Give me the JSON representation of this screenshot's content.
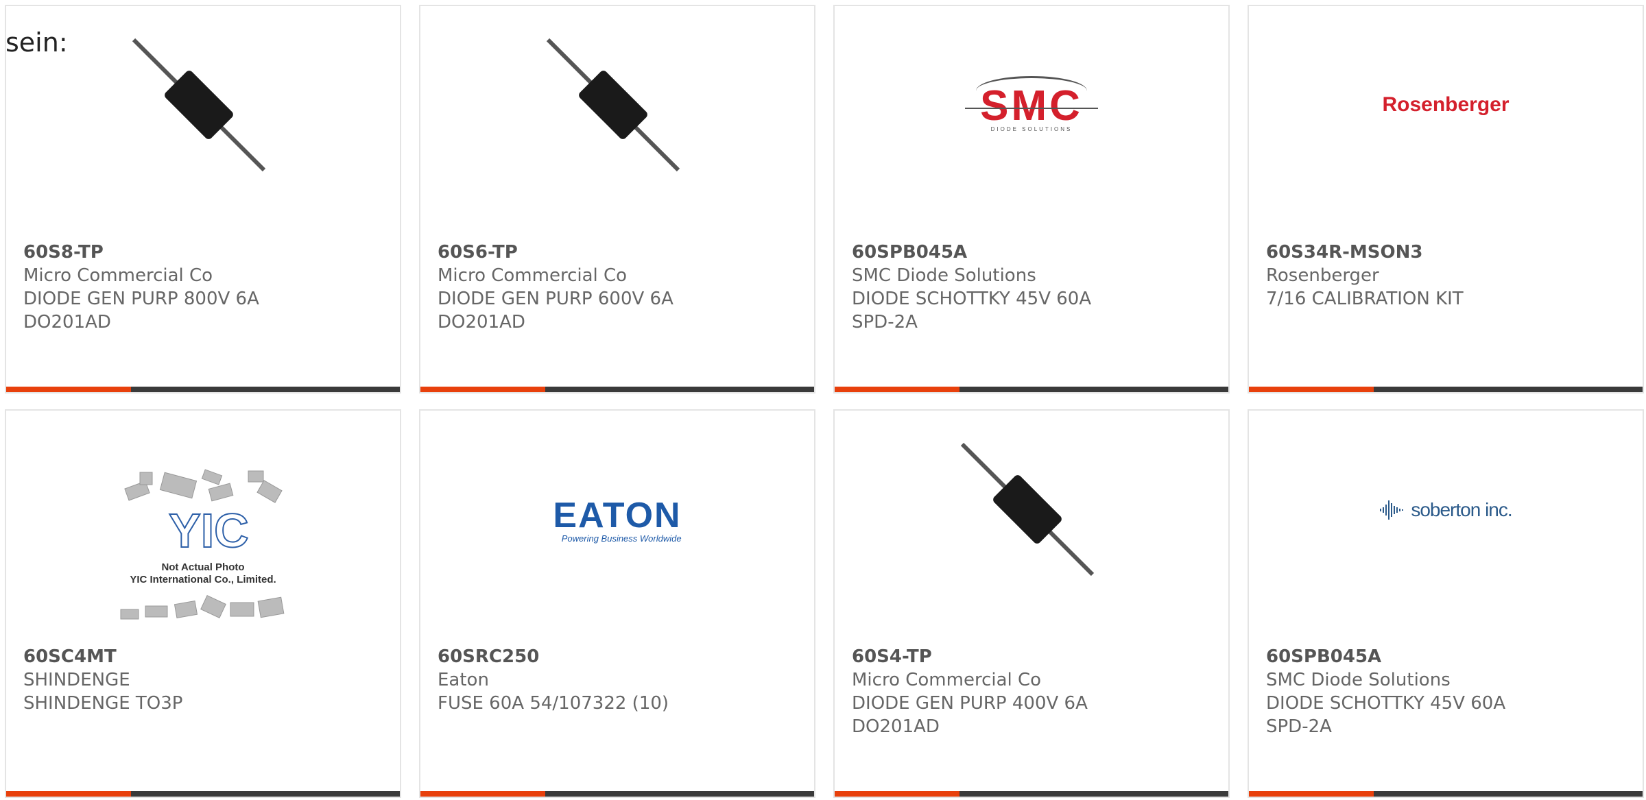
{
  "intro_text": "sein:",
  "products": [
    {
      "part": "60S8-TP",
      "manufacturer": "Micro Commercial Co",
      "description": "DIODE GEN PURP 800V 6A DO201AD",
      "image_icon": "axial-diode-icon"
    },
    {
      "part": "60S6-TP",
      "manufacturer": "Micro Commercial Co",
      "description": "DIODE GEN PURP 600V 6A DO201AD",
      "image_icon": "axial-diode-icon"
    },
    {
      "part": "60SPB045A",
      "manufacturer": "SMC Diode Solutions",
      "description": "DIODE SCHOTTKY 45V 60A SPD-2A",
      "image_icon": "smc-logo"
    },
    {
      "part": "60S34R-MSON3",
      "manufacturer": "Rosenberger",
      "description": "7/16 CALIBRATION KIT",
      "image_icon": "rosenberger-logo"
    },
    {
      "part": "60SC4MT",
      "manufacturer": "SHINDENGE",
      "description": "SHINDENGE TO3P",
      "image_icon": "yic-placeholder"
    },
    {
      "part": "60SRC250",
      "manufacturer": "Eaton",
      "description": "FUSE 60A 54/107322 (10)",
      "image_icon": "eaton-logo"
    },
    {
      "part": "60S4-TP",
      "manufacturer": "Micro Commercial Co",
      "description": "DIODE GEN PURP 400V 6A DO201AD",
      "image_icon": "axial-diode-icon"
    },
    {
      "part": "60SPB045A",
      "manufacturer": "SMC Diode Solutions",
      "description": "DIODE SCHOTTKY 45V 60A SPD-2A",
      "image_icon": "soberton-logo"
    }
  ],
  "logos": {
    "smc_word": "SMC",
    "smc_sub": "DIODE SOLUTIONS",
    "rosenberger": "Rosenberger",
    "eaton_word": "EATON",
    "eaton_tag": "Powering Business Worldwide",
    "soberton": "soberton inc.",
    "yic_mark": "YIC",
    "yic_line1": "Not Actual Photo",
    "yic_line2": "YIC International Co., Limited."
  },
  "colors": {
    "accent": "#e8400c",
    "bar": "#3a3a3a",
    "border": "#e4e4e4",
    "text": "#666666"
  }
}
